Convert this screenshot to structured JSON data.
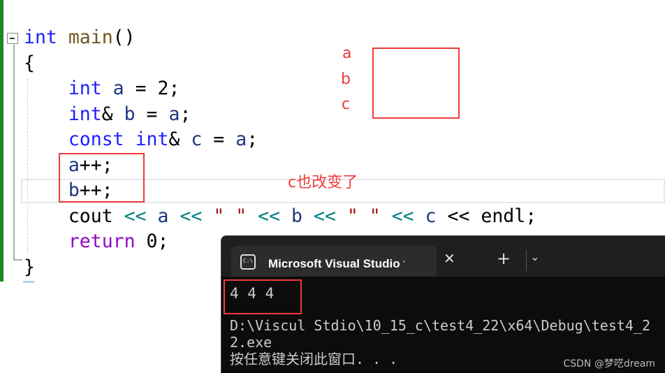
{
  "editor": {
    "lines": [
      [
        [
          "kw",
          "int"
        ],
        [
          "pl",
          " "
        ],
        [
          "fn",
          "main"
        ],
        [
          "pl",
          "()"
        ]
      ],
      [
        [
          "pl",
          "{"
        ]
      ],
      [
        [
          "pl",
          "    "
        ],
        [
          "kw",
          "int"
        ],
        [
          "pl",
          " "
        ],
        [
          "var",
          "a"
        ],
        [
          "pl",
          " = 2;"
        ]
      ],
      [
        [
          "pl",
          "    "
        ],
        [
          "kw",
          "int"
        ],
        [
          "pl",
          "& "
        ],
        [
          "var",
          "b"
        ],
        [
          "pl",
          " = "
        ],
        [
          "var",
          "a"
        ],
        [
          "pl",
          ";"
        ]
      ],
      [
        [
          "pl",
          "    "
        ],
        [
          "kw",
          "const"
        ],
        [
          "pl",
          " "
        ],
        [
          "kw",
          "int"
        ],
        [
          "pl",
          "& "
        ],
        [
          "var",
          "c"
        ],
        [
          "pl",
          " = "
        ],
        [
          "var",
          "a"
        ],
        [
          "pl",
          ";"
        ]
      ],
      [
        [
          "pl",
          "    "
        ],
        [
          "var",
          "a"
        ],
        [
          "pl",
          "++;"
        ]
      ],
      [
        [
          "pl",
          "    "
        ],
        [
          "var",
          "b"
        ],
        [
          "pl",
          "++;"
        ]
      ],
      [
        [
          "pl",
          "    cout "
        ],
        [
          "op",
          "<<"
        ],
        [
          "pl",
          " "
        ],
        [
          "var",
          "a"
        ],
        [
          "pl",
          " "
        ],
        [
          "op",
          "<<"
        ],
        [
          "pl",
          " "
        ],
        [
          "str",
          "\" \""
        ],
        [
          "pl",
          " "
        ],
        [
          "op",
          "<<"
        ],
        [
          "pl",
          " "
        ],
        [
          "var",
          "b"
        ],
        [
          "pl",
          " "
        ],
        [
          "op",
          "<<"
        ],
        [
          "pl",
          " "
        ],
        [
          "str",
          "\" \""
        ],
        [
          "pl",
          " "
        ],
        [
          "op",
          "<<"
        ],
        [
          "pl",
          " "
        ],
        [
          "var",
          "c"
        ],
        [
          "pl",
          " << endl;"
        ]
      ],
      [
        [
          "pl",
          "    "
        ],
        [
          "ret",
          "return"
        ],
        [
          "pl",
          " 0;"
        ]
      ],
      [
        [
          "pl",
          "}"
        ]
      ]
    ]
  },
  "annotations": {
    "labels": [
      "a",
      "b",
      "c"
    ],
    "note": "c也改变了",
    "color": "#f03a3a"
  },
  "terminal": {
    "tab_title": "Microsoft Visual Studio 调试控制台",
    "tab_icon": "C:\\",
    "close": "✕",
    "new_tab": "+",
    "dropdown": "⌄",
    "output": "4 4 4",
    "path_line": "D:\\Viscul Stdio\\10_15_c\\test4_22\\x64\\Debug\\test4_22.exe",
    "prompt_line": "按任意键关闭此窗口. . ."
  },
  "watermark": "CSDN @梦呓dream"
}
